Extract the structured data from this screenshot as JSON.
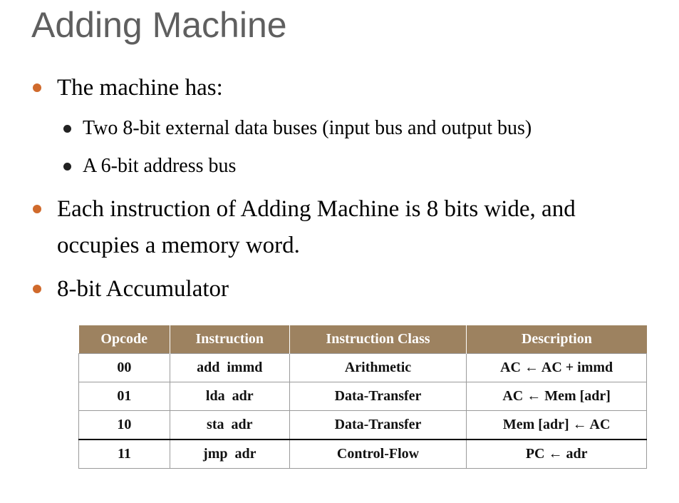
{
  "slide": {
    "title": "Adding Machine",
    "bullets": [
      "The machine has:",
      "Two 8-bit external data buses (input bus and output bus)",
      "A 6-bit address bus",
      "Each instruction of Adding Machine is 8 bits wide, and",
      "occupies a memory word.",
      "8-bit Accumulator"
    ]
  },
  "table": {
    "headers": [
      "Opcode",
      "Instruction",
      "Instruction Class",
      "Description"
    ],
    "rows": [
      [
        "00",
        "add  immd",
        "Arithmetic",
        "AC ← AC + immd"
      ],
      [
        "01",
        "lda  adr",
        "Data-Transfer",
        "AC ← Mem [adr]"
      ],
      [
        "10",
        "sta  adr",
        "Data-Transfer",
        "Mem [adr] ← AC"
      ],
      [
        "11",
        "jmp  adr",
        "Control-Flow",
        "PC ← adr"
      ]
    ]
  },
  "colors": {
    "title": "#5f5f5f",
    "bullet_accent": "#d06a2c",
    "table_header_bg": "#9d8260"
  }
}
